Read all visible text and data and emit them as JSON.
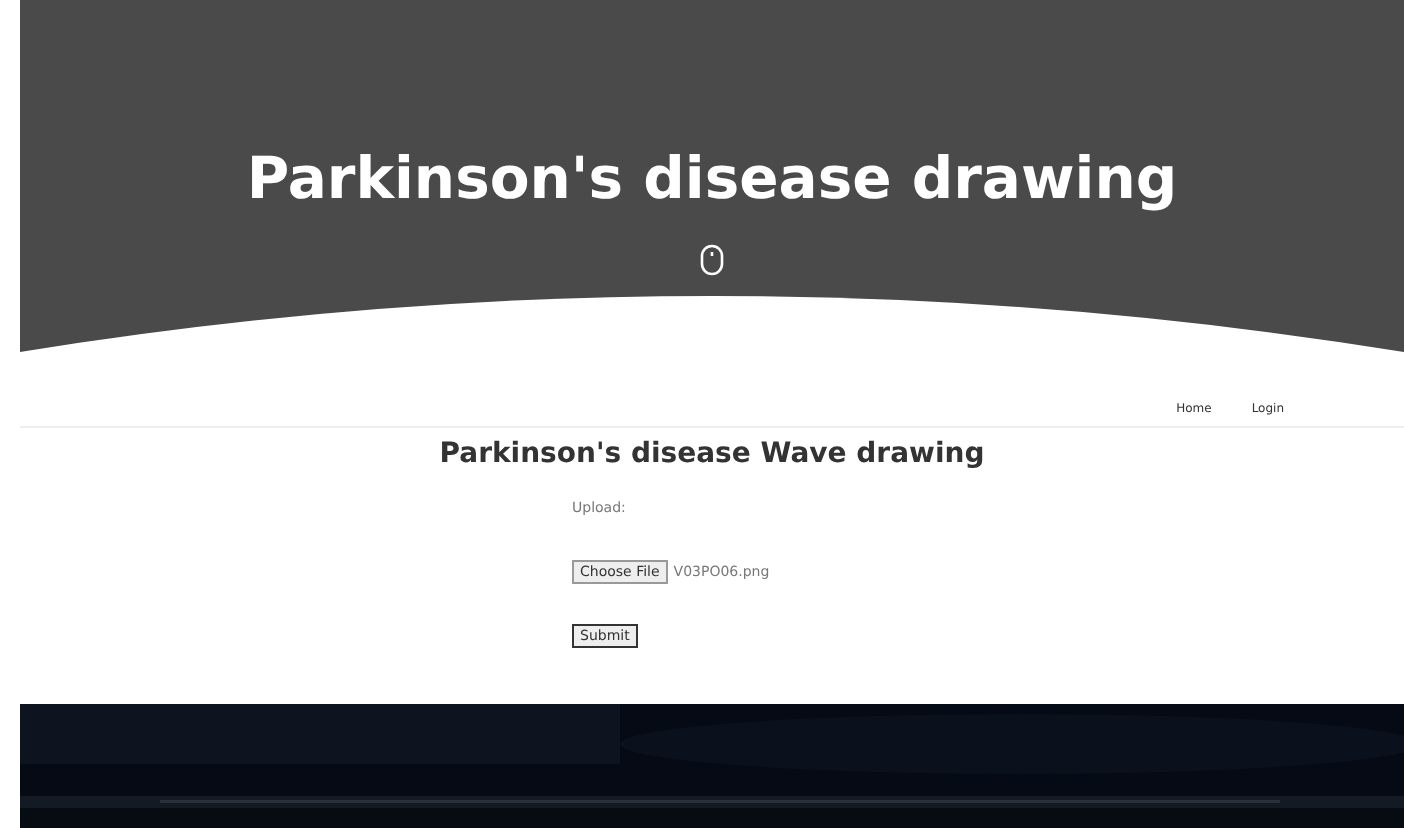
{
  "hero": {
    "title": "Parkinson's disease drawing"
  },
  "nav": {
    "links": [
      {
        "label": "Home"
      },
      {
        "label": "Login"
      }
    ]
  },
  "form": {
    "heading": "Parkinson's disease Wave drawing",
    "upload_label": "Upload:",
    "file_button": "Choose File",
    "file_name": "V03PO06.png",
    "submit": "Submit"
  }
}
